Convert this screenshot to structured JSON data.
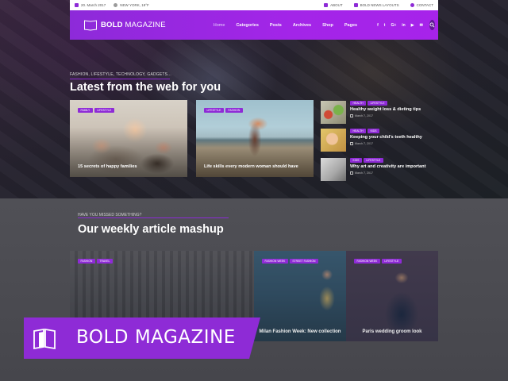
{
  "topbar": {
    "date": "20. March 2017",
    "weather": "NEW YORK, 19°F",
    "links": [
      "ABOUT",
      "BOLD NEWS LAYOUTS",
      "CONTACT"
    ]
  },
  "nav": {
    "logo_bold": "BOLD",
    "logo_rest": " MAGAZINE",
    "menu": [
      "Home",
      "Categories",
      "Posts",
      "Archives",
      "Shop",
      "Pages"
    ],
    "socials": [
      "f",
      "t",
      "G+",
      "in",
      "▶",
      "✉"
    ]
  },
  "hero": {
    "kicker": "FASHION, LIFESTYLE, TECHNOLOGY, GADGETS...",
    "title": "Latest from the web for you",
    "cards": [
      {
        "tags": [
          "FAMILY",
          "LIFESTYLE"
        ],
        "title": "15 secrets of happy families"
      },
      {
        "tags": [
          "LIFESTYLE",
          "FASHION"
        ],
        "title": "Life skills every modern woman should have"
      }
    ],
    "list": [
      {
        "tags": [
          "HEALTH",
          "LIFESTYLE"
        ],
        "title": "Healthy weight loss & dieting tips",
        "date": "March 7, 2017"
      },
      {
        "tags": [
          "HEALTH",
          "KIDS"
        ],
        "title": "Keeping your child's teeth healthy",
        "date": "March 7, 2017"
      },
      {
        "tags": [
          "KIDS",
          "LIFESTYLE"
        ],
        "title": "Why art and creativity are important",
        "date": "March 7, 2017"
      }
    ]
  },
  "mashup": {
    "kicker": "HAVE YOU MISSED SOMETHING?",
    "title": "Our weekly article mashup",
    "cards": [
      {
        "tags": [
          "FASHION",
          "TRAVEL"
        ],
        "title": ""
      },
      {
        "tags": [
          "FASHION WEEK",
          "STREET FASHION"
        ],
        "title": "Milan Fashion Week: New collection"
      },
      {
        "tags": [
          "FASHION WEEK",
          "LIFESTYLE"
        ],
        "title": "Paris wedding groom look"
      }
    ]
  },
  "brand": {
    "label": "BOLD MAGAZINE"
  },
  "colors": {
    "accent": "#8e2bd6",
    "nav_end": "#a723ea"
  }
}
